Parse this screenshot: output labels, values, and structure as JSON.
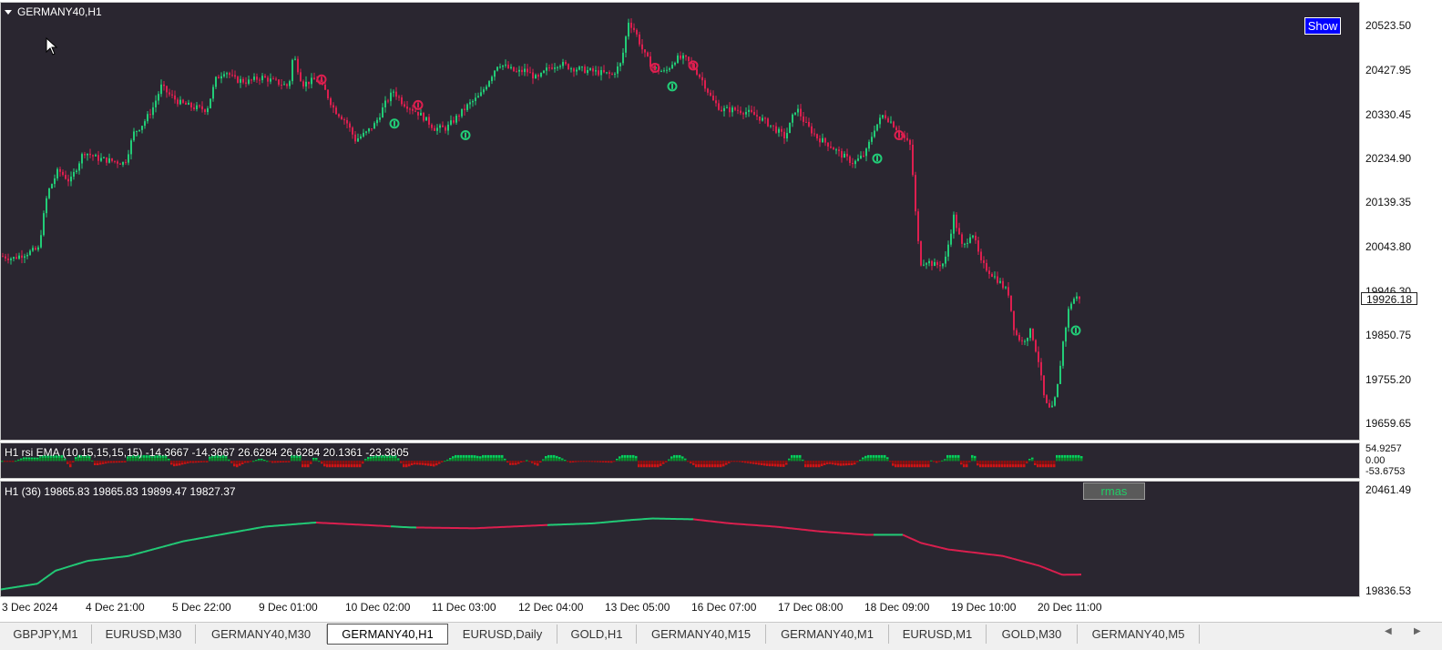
{
  "window": {
    "symbol_title": "GERMANY40,H1",
    "show_button": "Show"
  },
  "price_axis": {
    "ticks": [
      "20523.50",
      "20427.95",
      "20330.45",
      "20234.90",
      "20139.35",
      "20043.80",
      "19946.30",
      "19850.75",
      "19755.20",
      "19659.65"
    ],
    "current_price": "19926.18"
  },
  "rsi_panel": {
    "label": "H1 rsi  EMA (10,15,15,15,15) -14.3667 -14.3667 26.6284 26.6284 20.1361 -23.3805",
    "ticks": [
      "54.9257",
      "0.00",
      "-53.6753"
    ]
  },
  "rmas_panel": {
    "label": "H1  (36) 19865.83 19865.83 19899.47 19827.37",
    "button": "rmas",
    "ticks": [
      "20461.49",
      "19836.53"
    ]
  },
  "time_axis": [
    "3 Dec 2024",
    "4 Dec 21:00",
    "5 Dec 22:00",
    "9 Dec 01:00",
    "10 Dec 02:00",
    "11 Dec 03:00",
    "12 Dec 04:00",
    "13 Dec 05:00",
    "16 Dec 07:00",
    "17 Dec 08:00",
    "18 Dec 09:00",
    "19 Dec 10:00",
    "20 Dec 11:00"
  ],
  "tabs": [
    {
      "label": "GBPJPY,M1",
      "active": false
    },
    {
      "label": "EURUSD,M30",
      "active": false
    },
    {
      "label": "GERMANY40,M30",
      "active": false
    },
    {
      "label": "GERMANY40,H1",
      "active": true
    },
    {
      "label": "EURUSD,Daily",
      "active": false
    },
    {
      "label": "GOLD,H1",
      "active": false
    },
    {
      "label": "GERMANY40,M15",
      "active": false
    },
    {
      "label": "GERMANY40,M1",
      "active": false
    },
    {
      "label": "EURUSD,M1",
      "active": false
    },
    {
      "label": "GOLD,M30",
      "active": false
    },
    {
      "label": "GERMANY40,M5",
      "active": false
    }
  ],
  "colors": {
    "bull": "#22cc77",
    "bear": "#dd1f4f",
    "background": "#2a2630",
    "rsi_pos": "#00ee66",
    "rsi_neg": "#ee1111"
  },
  "chart_data": {
    "type": "candlestick",
    "ylim": [
      19620,
      20560
    ],
    "price_path": [
      [
        0,
        20015
      ],
      [
        12,
        20010
      ],
      [
        25,
        20020
      ],
      [
        40,
        20030
      ],
      [
        50,
        20150
      ],
      [
        62,
        20200
      ],
      [
        75,
        20175
      ],
      [
        90,
        20240
      ],
      [
        105,
        20225
      ],
      [
        120,
        20220
      ],
      [
        135,
        20215
      ],
      [
        145,
        20280
      ],
      [
        155,
        20300
      ],
      [
        165,
        20330
      ],
      [
        175,
        20380
      ],
      [
        185,
        20360
      ],
      [
        195,
        20345
      ],
      [
        210,
        20335
      ],
      [
        225,
        20330
      ],
      [
        235,
        20395
      ],
      [
        245,
        20415
      ],
      [
        255,
        20395
      ],
      [
        270,
        20390
      ],
      [
        285,
        20400
      ],
      [
        300,
        20390
      ],
      [
        315,
        20380
      ],
      [
        320,
        20450
      ],
      [
        330,
        20385
      ],
      [
        345,
        20395
      ],
      [
        355,
        20370
      ],
      [
        365,
        20330
      ],
      [
        378,
        20305
      ],
      [
        388,
        20265
      ],
      [
        400,
        20280
      ],
      [
        410,
        20300
      ],
      [
        420,
        20340
      ],
      [
        430,
        20370
      ],
      [
        440,
        20345
      ],
      [
        452,
        20330
      ],
      [
        462,
        20315
      ],
      [
        475,
        20290
      ],
      [
        488,
        20290
      ],
      [
        500,
        20315
      ],
      [
        512,
        20340
      ],
      [
        525,
        20360
      ],
      [
        535,
        20395
      ],
      [
        545,
        20430
      ],
      [
        555,
        20420
      ],
      [
        565,
        20410
      ],
      [
        575,
        20415
      ],
      [
        588,
        20395
      ],
      [
        600,
        20420
      ],
      [
        612,
        20430
      ],
      [
        625,
        20420
      ],
      [
        640,
        20415
      ],
      [
        655,
        20410
      ],
      [
        670,
        20405
      ],
      [
        680,
        20430
      ],
      [
        688,
        20520
      ],
      [
        695,
        20500
      ],
      [
        705,
        20450
      ],
      [
        715,
        20420
      ],
      [
        728,
        20410
      ],
      [
        740,
        20440
      ],
      [
        750,
        20440
      ],
      [
        760,
        20420
      ],
      [
        770,
        20390
      ],
      [
        780,
        20350
      ],
      [
        790,
        20330
      ],
      [
        805,
        20330
      ],
      [
        818,
        20325
      ],
      [
        830,
        20315
      ],
      [
        845,
        20295
      ],
      [
        860,
        20270
      ],
      [
        872,
        20335
      ],
      [
        882,
        20300
      ],
      [
        895,
        20270
      ],
      [
        908,
        20255
      ],
      [
        920,
        20235
      ],
      [
        935,
        20215
      ],
      [
        948,
        20235
      ],
      [
        958,
        20290
      ],
      [
        968,
        20320
      ],
      [
        978,
        20300
      ],
      [
        988,
        20275
      ],
      [
        998,
        20250
      ],
      [
        1002,
        20130
      ],
      [
        1008,
        20000
      ],
      [
        1015,
        20005
      ],
      [
        1025,
        19995
      ],
      [
        1035,
        20000
      ],
      [
        1045,
        20100
      ],
      [
        1055,
        20030
      ],
      [
        1065,
        20070
      ],
      [
        1075,
        20000
      ],
      [
        1085,
        19980
      ],
      [
        1095,
        19960
      ],
      [
        1105,
        19935
      ],
      [
        1112,
        19850
      ],
      [
        1120,
        19830
      ],
      [
        1130,
        19855
      ],
      [
        1138,
        19790
      ],
      [
        1145,
        19700
      ],
      [
        1152,
        19680
      ],
      [
        1158,
        19720
      ],
      [
        1165,
        19830
      ],
      [
        1172,
        19910
      ],
      [
        1178,
        19926
      ],
      [
        1185,
        19926
      ]
    ],
    "markers": [
      {
        "t": 352,
        "p": 20395,
        "dir": "down"
      },
      {
        "t": 432,
        "p": 20300,
        "dir": "up"
      },
      {
        "t": 458,
        "p": 20340,
        "dir": "down"
      },
      {
        "t": 510,
        "p": 20275,
        "dir": "up"
      },
      {
        "t": 718,
        "p": 20420,
        "dir": "down"
      },
      {
        "t": 737,
        "p": 20380,
        "dir": "up"
      },
      {
        "t": 760,
        "p": 20425,
        "dir": "down"
      },
      {
        "t": 962,
        "p": 20225,
        "dir": "up"
      },
      {
        "t": 986,
        "p": 20275,
        "dir": "down"
      },
      {
        "t": 1180,
        "p": 19855,
        "dir": "up"
      }
    ],
    "rma_line": [
      [
        0,
        19845
      ],
      [
        40,
        19880
      ],
      [
        60,
        19960
      ],
      [
        95,
        20020
      ],
      [
        140,
        20050
      ],
      [
        200,
        20140
      ],
      [
        240,
        20180
      ],
      [
        290,
        20230
      ],
      [
        345,
        20255
      ],
      [
        400,
        20240
      ],
      [
        450,
        20225
      ],
      [
        520,
        20220
      ],
      [
        600,
        20240
      ],
      [
        650,
        20250
      ],
      [
        690,
        20270
      ],
      [
        715,
        20280
      ],
      [
        760,
        20275
      ],
      [
        800,
        20250
      ],
      [
        850,
        20230
      ],
      [
        900,
        20200
      ],
      [
        950,
        20180
      ],
      [
        990,
        20180
      ],
      [
        1010,
        20130
      ],
      [
        1040,
        20090
      ],
      [
        1100,
        20050
      ],
      [
        1140,
        19990
      ],
      [
        1165,
        19935
      ],
      [
        1185,
        19936
      ]
    ],
    "rma_bull_segments": [
      [
        0,
        345
      ],
      [
        428,
        455
      ],
      [
        600,
        760
      ],
      [
        958,
        990
      ]
    ],
    "rma_ylim": [
      19836.53,
      20461.49
    ],
    "rsi_ylim": [
      -53.6753,
      54.9257
    ]
  }
}
